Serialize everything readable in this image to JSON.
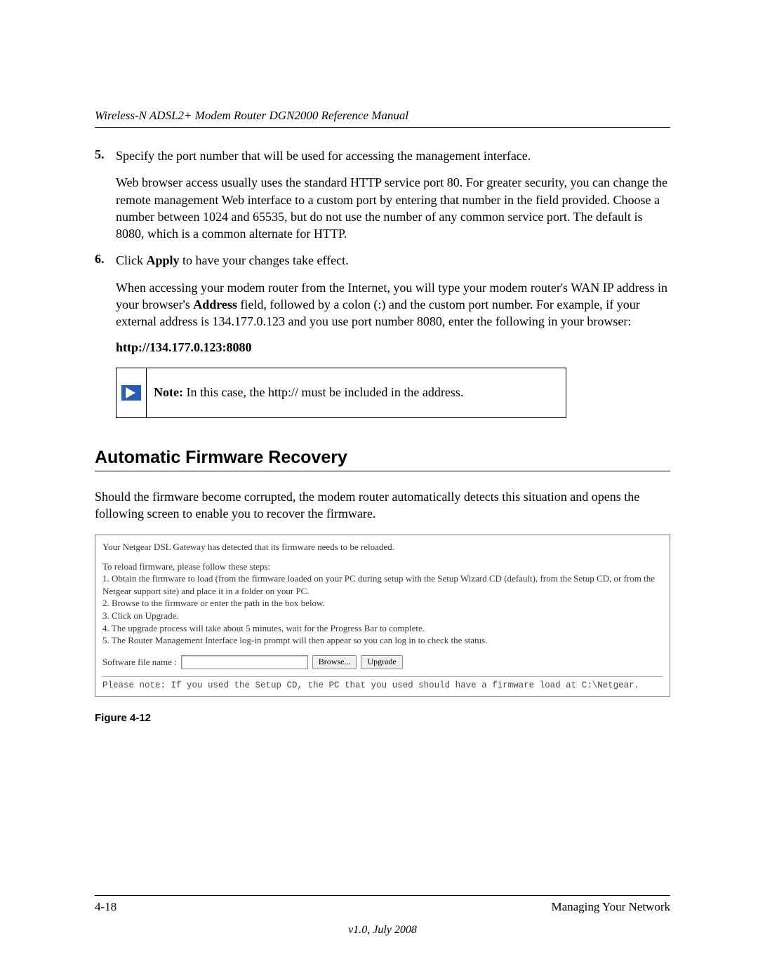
{
  "header": {
    "title": "Wireless-N ADSL2+ Modem Router DGN2000 Reference Manual"
  },
  "list": {
    "item5": {
      "num": "5.",
      "line1": "Specify the port number that will be used for accessing the management interface.",
      "para": "Web browser access usually uses the standard HTTP service port 80. For greater security, you can change the remote management Web interface to a custom port by entering that number in the field provided. Choose a number between 1024 and 65535, but do not use the number of any common service port. The default is 8080, which is a common alternate for HTTP."
    },
    "item6": {
      "num": "6.",
      "click": "Click ",
      "apply": "Apply",
      "click_tail": " to have your changes take effect.",
      "para_a": "When accessing your modem router from the Internet, you will type your modem router's WAN IP address in your browser's ",
      "address": "Address",
      "para_b": " field, followed by a colon (:) and the custom port number. For example, if your external address is 134.177.0.123 and you use port number 8080, enter the following in your browser:"
    }
  },
  "url_example": "http://134.177.0.123:8080",
  "note": {
    "label": "Note:",
    "text": " In this case, the http:// must be included in the address."
  },
  "section": {
    "heading": "Automatic Firmware Recovery",
    "intro": "Should the firmware become corrupted, the modem router automatically detects this situation and opens the following screen to enable you to recover the firmware."
  },
  "recovery": {
    "lead": "Your Netgear DSL Gateway has detected that its firmware needs to be reloaded.",
    "steps_title": "To reload firmware, please follow these steps:",
    "s1": "1. Obtain the firmware to load (from the firmware loaded on your PC during setup with the Setup Wizard CD (default), from the Setup CD, or from the Netgear support site) and place it in a folder on your PC.",
    "s2": "2. Browse to the firmware or enter the path in the box below.",
    "s3": "3. Click on Upgrade.",
    "s4": "4. The upgrade process will take about 5 minutes, wait for the Progress Bar to complete.",
    "s5": "5. The Router Management Interface log-in prompt will then appear so you can log in to check the status.",
    "file_label": "Software file name : ",
    "browse": "Browse...",
    "upgrade": "Upgrade",
    "mono": "Please note: If you used the Setup CD, the PC that you used should have a firmware load at C:\\Netgear."
  },
  "figure_caption": "Figure 4-12",
  "footer": {
    "page_num": "4-18",
    "section": "Managing Your Network",
    "version": "v1.0, July 2008"
  }
}
